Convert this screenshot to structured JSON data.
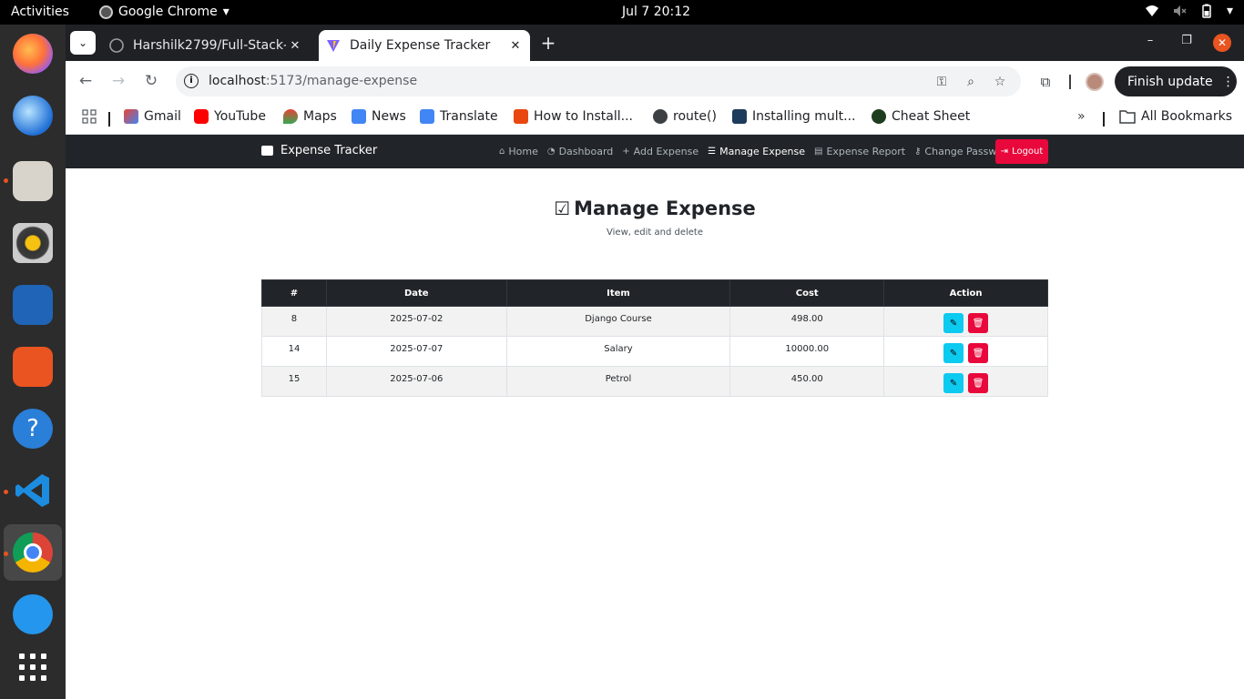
{
  "system": {
    "activities": "Activities",
    "app_name": "Google Chrome",
    "clock": "Jul 7  20:12"
  },
  "browser": {
    "tabs": [
      {
        "title": "Harshilk2799/Full-Stack-",
        "active": false
      },
      {
        "title": "Daily Expense Tracker",
        "active": true
      }
    ],
    "url_host": "localhost",
    "url_rest": ":5173/manage-expense",
    "finish_update": "Finish update",
    "bookmarks": [
      {
        "label": "Gmail",
        "icon": "gmail-icon"
      },
      {
        "label": "YouTube",
        "icon": "youtube-icon"
      },
      {
        "label": "Maps",
        "icon": "maps-icon"
      },
      {
        "label": "News",
        "icon": "news-icon"
      },
      {
        "label": "Translate",
        "icon": "translate-icon"
      },
      {
        "label": "How to Install...",
        "icon": "bookmark-site-icon"
      },
      {
        "label": "route()",
        "icon": "globe-icon"
      },
      {
        "label": "Installing mult...",
        "icon": "tds-icon"
      },
      {
        "label": "Cheat Sheet",
        "icon": "cheat-sheet-icon"
      }
    ],
    "all_bookmarks": "All Bookmarks"
  },
  "app": {
    "brand": "Expense Tracker",
    "nav": [
      {
        "label": "Home",
        "icon": "home-icon",
        "active": false
      },
      {
        "label": "Dashboard",
        "icon": "dashboard-icon",
        "active": false
      },
      {
        "label": "Add Expense",
        "icon": "plus-icon",
        "active": false
      },
      {
        "label": "Manage Expense",
        "icon": "list-check-icon",
        "active": true
      },
      {
        "label": "Expense Report",
        "icon": "file-icon",
        "active": false
      },
      {
        "label": "Change Password",
        "icon": "key-icon",
        "active": false
      }
    ],
    "logout": "Logout",
    "title": "Manage Expense",
    "subtitle": "View, edit and delete",
    "table": {
      "headers": [
        "#",
        "Date",
        "Item",
        "Cost",
        "Action"
      ],
      "rows": [
        {
          "id": "8",
          "date": "2025-07-02",
          "item": "Django Course",
          "cost": "498.00"
        },
        {
          "id": "14",
          "date": "2025-07-07",
          "item": "Salary",
          "cost": "10000.00"
        },
        {
          "id": "15",
          "date": "2025-07-06",
          "item": "Petrol",
          "cost": "450.00"
        }
      ]
    }
  },
  "colors": {
    "navbar": "#212529",
    "logout": "#e9083b",
    "edit_button": "#0dcaf0",
    "delete_button": "#e9083b"
  }
}
